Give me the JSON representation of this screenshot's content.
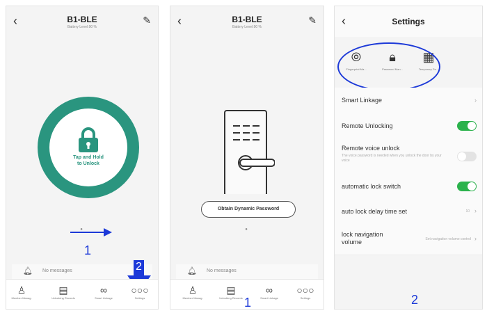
{
  "panel1": {
    "title": "B1-BLE",
    "subtitle": "Battery Level:90 %",
    "unlock_text_1": "Tap and Hold",
    "unlock_text_2": "to Unlock",
    "messages": "No messages",
    "tabs": [
      "Member Manag.",
      "Unlocking Records",
      "Smart Linkage",
      "Settings"
    ],
    "annotation_1": "1",
    "annotation_2": "2"
  },
  "panel2": {
    "title": "B1-BLE",
    "subtitle": "Battery Level:90 %",
    "dynamic_button": "Obtain Dynamic Password",
    "messages": "No messages",
    "tabs": [
      "Member Manag.",
      "Unlocking Records",
      "Smart Linkage",
      "Settings"
    ],
    "annotation_1": "1"
  },
  "panel3": {
    "title": "Settings",
    "icons": [
      "Fingerprint Ma...",
      "Password Man...",
      "Temporary Pa..."
    ],
    "rows": {
      "smart_linkage": "Smart Linkage",
      "remote_unlocking": "Remote Unlocking",
      "remote_voice": "Remote voice unlock",
      "remote_voice_desc": "The voice password is needed when you unlock the door by your voice",
      "auto_lock": "automatic lock switch",
      "auto_delay": "auto lock delay time set",
      "auto_delay_value": "10",
      "nav_volume": "lock navigation volume",
      "nav_volume_value": "Set navigation volume control"
    },
    "toggles": {
      "remote_unlocking": true,
      "remote_voice": false,
      "auto_lock": true
    },
    "annotation_2": "2"
  },
  "colors": {
    "accent_green": "#2a957f",
    "toggle_green": "#2bb24c",
    "annotation_blue": "#1c39d8"
  }
}
